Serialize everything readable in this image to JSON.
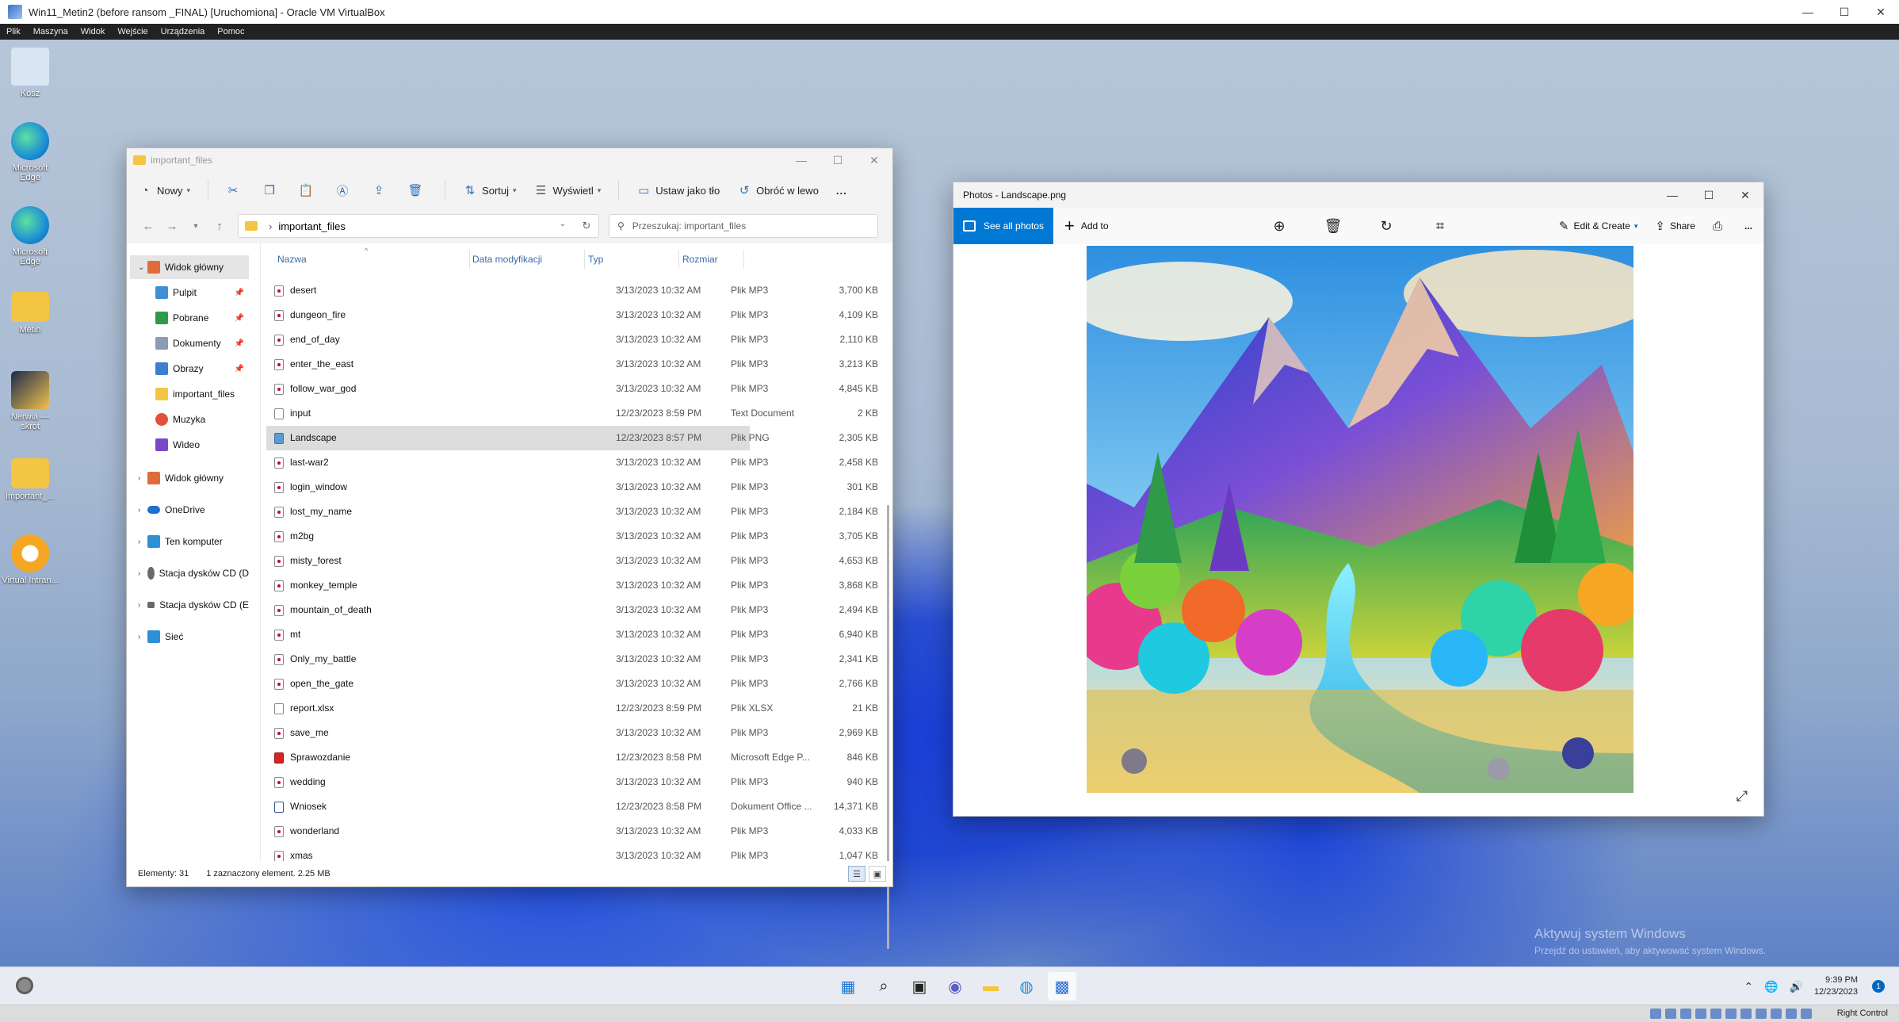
{
  "vbox": {
    "title": "Win11_Metin2 (before ransom _FINAL) [Uruchomiona] - Oracle VM VirtualBox",
    "menu": [
      "Plik",
      "Maszyna",
      "Widok",
      "Wejście",
      "Urządzenia",
      "Pomoc"
    ],
    "host_key": "Right Control"
  },
  "desktop": {
    "icons": [
      {
        "label": "Kosz",
        "icon": "recycle-bin-icon",
        "color": "#d9e6f2"
      },
      {
        "label": "Microsoft Edge",
        "icon": "edge-icon",
        "color": "#1d8fd6"
      },
      {
        "label": "Microsoft Edge",
        "icon": "edge-icon",
        "color": "#1d8fd6"
      },
      {
        "label": "Metin",
        "icon": "folder-icon",
        "color": "#f4c542"
      },
      {
        "label": "Nerwia — skrót",
        "icon": "app-shortcut-icon",
        "color": "#1b2a4a"
      },
      {
        "label": "important_...",
        "icon": "folder-icon",
        "color": "#f4c542"
      },
      {
        "label": "Virtual Intran...",
        "icon": "app-icon",
        "color": "#f5a623"
      }
    ],
    "watermark_title": "Aktywuj system Windows",
    "watermark_sub": "Przejdź do ustawień, aby aktywować system Windows."
  },
  "explorer": {
    "title": "important_files",
    "toolbar": {
      "new": "Nowy",
      "sort": "Sortuj",
      "view": "Wyświetl",
      "set_bg": "Ustaw jako tło",
      "rotate": "Obróć w lewo",
      "more": "..."
    },
    "address": "important_files",
    "search_placeholder": "Przeszukaj: important_files",
    "nav": [
      {
        "label": "Widok główny",
        "icon": "home-icon",
        "color": "#e06c3c"
      },
      {
        "label": "Pulpit",
        "icon": "desktop-icon",
        "color": "#3f8ed8"
      },
      {
        "label": "Pobrane",
        "icon": "download-icon",
        "color": "#2d9a4c"
      },
      {
        "label": "Dokumenty",
        "icon": "documents-icon",
        "color": "#8a9bb3"
      },
      {
        "label": "Obrazy",
        "icon": "pictures-icon",
        "color": "#3a7fd0"
      },
      {
        "label": "important_files",
        "icon": "folder-icon",
        "color": "#f4c542"
      },
      {
        "label": "Muzyka",
        "icon": "music-icon",
        "color": "#e0533a"
      },
      {
        "label": "Wideo",
        "icon": "video-icon",
        "color": "#7b47c9"
      },
      {
        "label": "Widok główny",
        "icon": "home-icon",
        "color": "#e06c3c"
      },
      {
        "label": "OneDrive",
        "icon": "onedrive-icon",
        "color": "#1f6fd1"
      },
      {
        "label": "Ten komputer",
        "icon": "computer-icon",
        "color": "#2f8fd6"
      },
      {
        "label": "Stacja dysków CD (D",
        "icon": "cd-drive-icon",
        "color": "#6a6a6a"
      },
      {
        "label": "Stacja dysków CD (E",
        "icon": "cd-drive-icon",
        "color": "#6a6a6a"
      },
      {
        "label": "Sieć",
        "icon": "network-icon",
        "color": "#2f8fd6"
      }
    ],
    "columns": {
      "name": "Nazwa",
      "date": "Data modyfikacji",
      "type": "Typ",
      "size": "Rozmiar"
    },
    "files": [
      {
        "name": "desert",
        "date": "3/13/2023 10:32 AM",
        "type": "Plik MP3",
        "size": "3,700 KB",
        "kind": "mp3"
      },
      {
        "name": "dungeon_fire",
        "date": "3/13/2023 10:32 AM",
        "type": "Plik MP3",
        "size": "4,109 KB",
        "kind": "mp3"
      },
      {
        "name": "end_of_day",
        "date": "3/13/2023 10:32 AM",
        "type": "Plik MP3",
        "size": "2,110 KB",
        "kind": "mp3"
      },
      {
        "name": "enter_the_east",
        "date": "3/13/2023 10:32 AM",
        "type": "Plik MP3",
        "size": "3,213 KB",
        "kind": "mp3"
      },
      {
        "name": "follow_war_god",
        "date": "3/13/2023 10:32 AM",
        "type": "Plik MP3",
        "size": "4,845 KB",
        "kind": "mp3"
      },
      {
        "name": "input",
        "date": "12/23/2023 8:59 PM",
        "type": "Text Document",
        "size": "2 KB",
        "kind": "txt"
      },
      {
        "name": "Landscape",
        "date": "12/23/2023 8:57 PM",
        "type": "Plik PNG",
        "size": "2,305 KB",
        "kind": "png",
        "selected": true
      },
      {
        "name": "last-war2",
        "date": "3/13/2023 10:32 AM",
        "type": "Plik MP3",
        "size": "2,458 KB",
        "kind": "mp3"
      },
      {
        "name": "login_window",
        "date": "3/13/2023 10:32 AM",
        "type": "Plik MP3",
        "size": "301 KB",
        "kind": "mp3"
      },
      {
        "name": "lost_my_name",
        "date": "3/13/2023 10:32 AM",
        "type": "Plik MP3",
        "size": "2,184 KB",
        "kind": "mp3"
      },
      {
        "name": "m2bg",
        "date": "3/13/2023 10:32 AM",
        "type": "Plik MP3",
        "size": "3,705 KB",
        "kind": "mp3"
      },
      {
        "name": "misty_forest",
        "date": "3/13/2023 10:32 AM",
        "type": "Plik MP3",
        "size": "4,653 KB",
        "kind": "mp3"
      },
      {
        "name": "monkey_temple",
        "date": "3/13/2023 10:32 AM",
        "type": "Plik MP3",
        "size": "3,868 KB",
        "kind": "mp3"
      },
      {
        "name": "mountain_of_death",
        "date": "3/13/2023 10:32 AM",
        "type": "Plik MP3",
        "size": "2,494 KB",
        "kind": "mp3"
      },
      {
        "name": "mt",
        "date": "3/13/2023 10:32 AM",
        "type": "Plik MP3",
        "size": "6,940 KB",
        "kind": "mp3"
      },
      {
        "name": "Only_my_battle",
        "date": "3/13/2023 10:32 AM",
        "type": "Plik MP3",
        "size": "2,341 KB",
        "kind": "mp3"
      },
      {
        "name": "open_the_gate",
        "date": "3/13/2023 10:32 AM",
        "type": "Plik MP3",
        "size": "2,766 KB",
        "kind": "mp3"
      },
      {
        "name": "report.xlsx",
        "date": "12/23/2023 8:59 PM",
        "type": "Plik XLSX",
        "size": "21 KB",
        "kind": "xlsx"
      },
      {
        "name": "save_me",
        "date": "3/13/2023 10:32 AM",
        "type": "Plik MP3",
        "size": "2,969 KB",
        "kind": "mp3"
      },
      {
        "name": "Sprawozdanie",
        "date": "12/23/2023 8:58 PM",
        "type": "Microsoft Edge P...",
        "size": "846 KB",
        "kind": "pdf"
      },
      {
        "name": "wedding",
        "date": "3/13/2023 10:32 AM",
        "type": "Plik MP3",
        "size": "940 KB",
        "kind": "mp3"
      },
      {
        "name": "Wniosek",
        "date": "12/23/2023 8:58 PM",
        "type": "Dokument Office ...",
        "size": "14,371 KB",
        "kind": "docx"
      },
      {
        "name": "wonderland",
        "date": "3/13/2023 10:32 AM",
        "type": "Plik MP3",
        "size": "4,033 KB",
        "kind": "mp3"
      },
      {
        "name": "xmas",
        "date": "3/13/2023 10:32 AM",
        "type": "Plik MP3",
        "size": "1,047 KB",
        "kind": "mp3"
      }
    ],
    "status": {
      "count": "Elementy: 31",
      "selection": "1 zaznaczony element. 2.25 MB"
    }
  },
  "photos": {
    "title": "Photos - Landscape.png",
    "see_all": "See all photos",
    "add_to": "Add to",
    "edit_create": "Edit & Create",
    "share": "Share",
    "more": "..."
  },
  "taskbar": {
    "apps": [
      {
        "name": "start-icon",
        "glyph": "▦",
        "color": "#1a78d4"
      },
      {
        "name": "search-icon",
        "glyph": "⌕",
        "color": "#222222"
      },
      {
        "name": "task-view-icon",
        "glyph": "▣",
        "color": "#222222"
      },
      {
        "name": "chat-icon",
        "glyph": "◉",
        "color": "#5b5fc7"
      },
      {
        "name": "file-explorer-icon",
        "glyph": "▬",
        "color": "#f4c542"
      },
      {
        "name": "edge-icon",
        "glyph": "◍",
        "color": "#1d8fd6"
      },
      {
        "name": "photos-icon",
        "glyph": "▩",
        "color": "#2a6fd1"
      }
    ],
    "time": "9:39 PM",
    "date": "12/23/2023",
    "notifications": "1"
  }
}
